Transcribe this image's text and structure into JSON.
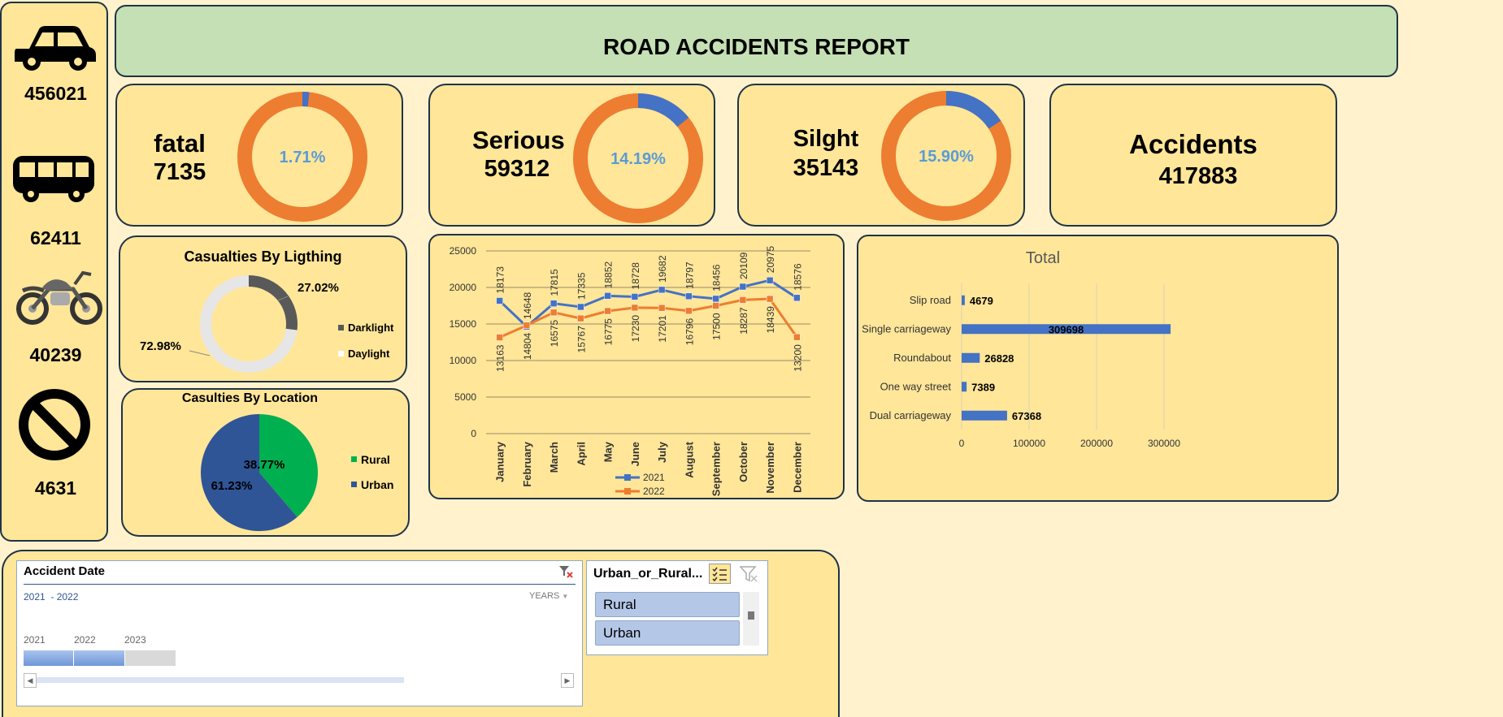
{
  "header": {
    "title": "ROAD ACCIDENTS REPORT"
  },
  "vehicles": [
    {
      "icon": "car-icon",
      "value": "456021"
    },
    {
      "icon": "bus-icon",
      "value": "62411"
    },
    {
      "icon": "motorcycle-icon",
      "value": "40239"
    },
    {
      "icon": "prohibited-icon",
      "value": "4631"
    }
  ],
  "kpis": {
    "fatal": {
      "label": "fatal",
      "value": "7135",
      "percent_label": "1.71%",
      "share": 0.0171
    },
    "serious": {
      "label": "Serious",
      "value": "59312",
      "percent_label": "14.19%",
      "share": 0.1419
    },
    "slight": {
      "label": "Silght",
      "value": "35143",
      "percent_label": "15.90%",
      "share": 0.159
    },
    "accidents": {
      "label": "Accidents",
      "value": "417883"
    }
  },
  "colors": {
    "page_bg": "#fff2cc",
    "panel_bg": "#ffe699",
    "header_bg": "#c5e0b4",
    "orange": "#ed7d31",
    "blue": "#4472c4",
    "green": "#00b050",
    "navy": "#2f5597",
    "dark_gray": "#595959",
    "light_gray": "#e7e6e6",
    "percent_text": "#5b9bd5"
  },
  "lighting": {
    "title": "Casualties By Ligthing",
    "slices": [
      {
        "name": "Darklight",
        "value": 27.02,
        "label": "27.02%",
        "color": "#595959"
      },
      {
        "name": "Daylight",
        "value": 72.98,
        "label": "72.98%",
        "color": "#e7e6e6"
      }
    ]
  },
  "location": {
    "title": "Casulties By Location",
    "slices": [
      {
        "name": "Rural",
        "value": 38.77,
        "label": "38.77%",
        "color": "#00b050"
      },
      {
        "name": "Urban",
        "value": 61.23,
        "label": "61.23%",
        "color": "#2f5597"
      }
    ]
  },
  "chart_data": [
    {
      "type": "line",
      "title": "",
      "categories": [
        "January",
        "February",
        "March",
        "April",
        "May",
        "June",
        "July",
        "August",
        "September",
        "October",
        "November",
        "December"
      ],
      "series": [
        {
          "name": "2021",
          "color": "#4472c4",
          "values": [
            18173,
            14648,
            17815,
            17335,
            18852,
            18728,
            19682,
            18797,
            18456,
            20109,
            20975,
            18576
          ]
        },
        {
          "name": "2022",
          "color": "#ed7d31",
          "values": [
            13163,
            14804,
            16575,
            15767,
            16775,
            17230,
            17201,
            16796,
            17500,
            18287,
            18439,
            13200
          ]
        }
      ],
      "ylim": [
        0,
        25000
      ],
      "yticks": [
        "0",
        "5000",
        "10000",
        "15000",
        "20000",
        "25000"
      ],
      "legend": "bottom",
      "grid": true
    },
    {
      "type": "bar",
      "orientation": "horizontal",
      "title": "Total",
      "categories": [
        "Slip road",
        "Single carriageway",
        "Roundabout",
        "One way street",
        "Dual carriageway"
      ],
      "values": [
        4679,
        309698,
        26828,
        7389,
        67368
      ],
      "value_labels": [
        "4679",
        "309698",
        "26828",
        "7389",
        "67368"
      ],
      "xlim": [
        0,
        300000
      ],
      "xticks": [
        "0",
        "100000",
        "200000",
        "300000"
      ],
      "color": "#4472c4",
      "grid": true
    }
  ],
  "date_slicer": {
    "title": "Accident Date",
    "range": "2021  - 2022",
    "level": "YEARS",
    "years": [
      "2021",
      "2022",
      "2023"
    ]
  },
  "area_slicer": {
    "title": "Urban_or_Rural...",
    "items": [
      "Rural",
      "Urban"
    ]
  }
}
